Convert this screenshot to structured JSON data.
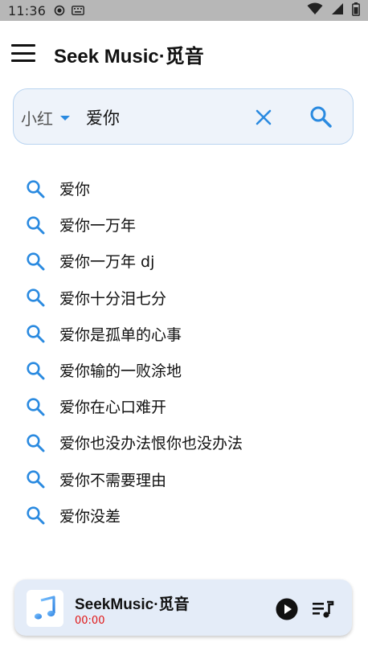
{
  "status_bar": {
    "time": "11:36"
  },
  "app_bar": {
    "title": "Seek Music·觅音"
  },
  "search": {
    "source": "小红",
    "query": "爱你"
  },
  "suggestions": [
    "爱你",
    "爱你一万年",
    "爱你一万年 dj",
    "爱你十分泪七分",
    "爱你是孤单的心事",
    "爱你输的一败涂地",
    "爱你在心口难开",
    "爱你也没办法恨你也没办法",
    "爱你不需要理由",
    "爱你没差"
  ],
  "player": {
    "title": "SeekMusic·觅音",
    "time": "00:00"
  },
  "colors": {
    "accent": "#2a8ae0",
    "time_red": "#e01616",
    "search_bg": "#eef3fa",
    "player_bg": "#e4ecf8"
  }
}
